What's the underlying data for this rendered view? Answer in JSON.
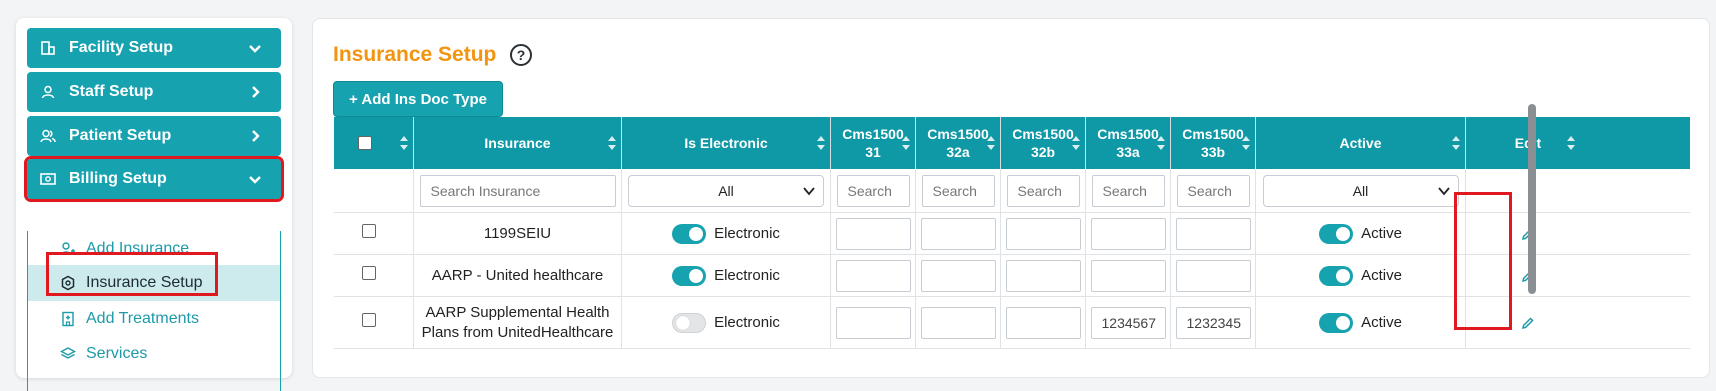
{
  "sidebar": {
    "items": [
      {
        "label": "Facility Setup",
        "icon": "building-icon",
        "chevron": "down"
      },
      {
        "label": "Staff Setup",
        "icon": "user-icon",
        "chevron": "right"
      },
      {
        "label": "Patient Setup",
        "icon": "users-icon",
        "chevron": "right"
      },
      {
        "label": "Billing Setup",
        "icon": "money-icon",
        "chevron": "down"
      }
    ],
    "billing_sub": [
      {
        "label": "Add Insurance",
        "icon": "user-plus-icon"
      },
      {
        "label": "Insurance Setup",
        "icon": "hexagon-icon"
      },
      {
        "label": "Add Treatments",
        "icon": "clinic-icon"
      },
      {
        "label": "Services",
        "icon": "layers-icon"
      }
    ]
  },
  "main": {
    "title": "Insurance Setup",
    "help": "?",
    "add_button": "+ Add Ins Doc Type"
  },
  "table": {
    "headers": {
      "insurance": "Insurance",
      "is_electronic": "Is Electronic",
      "c31_a": "Cms1500",
      "c31_b": "31",
      "c32a_a": "Cms1500",
      "c32a_b": "32a",
      "c32b_a": "Cms1500",
      "c32b_b": "32b",
      "c33a_a": "Cms1500",
      "c33a_b": "33a",
      "c33b_a": "Cms1500",
      "c33b_b": "33b",
      "active": "Active",
      "edit": "Edit"
    },
    "filters": {
      "insurance_placeholder": "Search Insurance",
      "electronic_value": "All",
      "cms_placeholder": "Search",
      "active_value": "All"
    },
    "rows": [
      {
        "insurance": "1199SEIU",
        "electronic_on": true,
        "electronic_label": "Electronic",
        "c31": "",
        "c32a": "",
        "c32b": "",
        "c33a": "",
        "c33b": "",
        "active_label": "Active"
      },
      {
        "insurance": "AARP - United healthcare",
        "electronic_on": true,
        "electronic_label": "Electronic",
        "c31": "",
        "c32a": "",
        "c32b": "",
        "c33a": "",
        "c33b": "",
        "active_label": "Active"
      },
      {
        "insurance": "AARP Supplemental Health Plans from UnitedHealthcare",
        "electronic_on": false,
        "electronic_label": "Electronic",
        "c31": "",
        "c32a": "",
        "c32b": "",
        "c33a": "1234567",
        "c33b": "1232345",
        "active_label": "Active"
      }
    ]
  },
  "colors": {
    "accent": "#17a2b0",
    "header": "#0f98a6",
    "title": "#f39410",
    "highlight": "#e0181f"
  }
}
